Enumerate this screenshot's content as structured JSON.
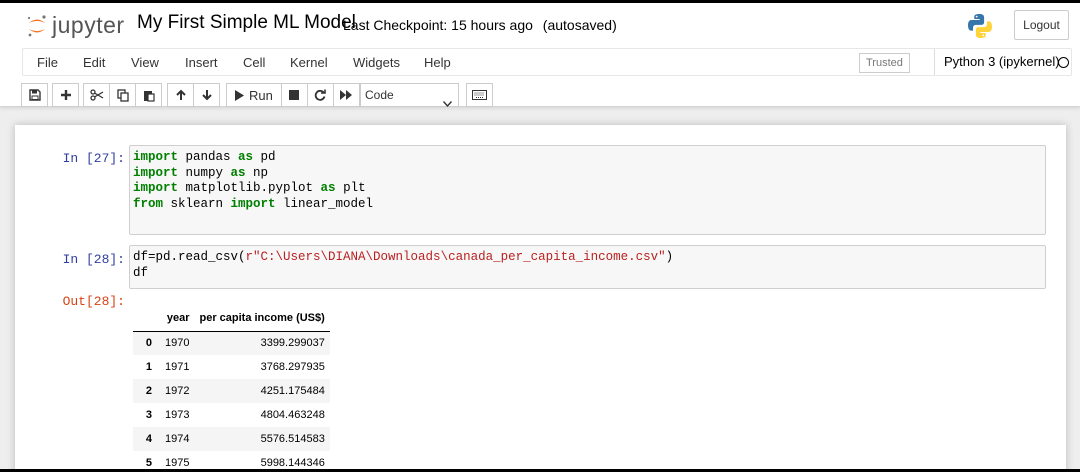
{
  "header": {
    "logo_text": "jupyter",
    "notebook_title": "My First Simple ML Model",
    "checkpoint": "Last Checkpoint: 15 hours ago",
    "autosaved": "(autosaved)",
    "logout_label": "Logout"
  },
  "menu": {
    "items": [
      "File",
      "Edit",
      "View",
      "Insert",
      "Cell",
      "Kernel",
      "Widgets",
      "Help"
    ],
    "trusted": "Trusted",
    "kernel": "Python 3 (ipykernel)"
  },
  "toolbar": {
    "run_label": "Run",
    "cell_type": "Code",
    "buttons": [
      "save-icon",
      "plus-icon",
      "cut-icon",
      "copy-icon",
      "paste-icon",
      "arrow-up-icon",
      "arrow-down-icon",
      "run-icon",
      "stop-icon",
      "restart-icon",
      "fast-forward-icon",
      "keyboard-icon"
    ]
  },
  "cells": [
    {
      "prompt": "In [27]:",
      "lines": [
        [
          {
            "t": "import",
            "k": "kw"
          },
          {
            "t": " pandas "
          },
          {
            "t": "as",
            "k": "kw"
          },
          {
            "t": " pd"
          }
        ],
        [
          {
            "t": "import",
            "k": "kw"
          },
          {
            "t": " numpy "
          },
          {
            "t": "as",
            "k": "kw"
          },
          {
            "t": " np"
          }
        ],
        [
          {
            "t": "import",
            "k": "kw"
          },
          {
            "t": " matplotlib.pyplot "
          },
          {
            "t": "as",
            "k": "kw"
          },
          {
            "t": " plt"
          }
        ],
        [
          {
            "t": "from",
            "k": "kw"
          },
          {
            "t": " sklearn "
          },
          {
            "t": "import",
            "k": "kw"
          },
          {
            "t": " linear_model"
          }
        ]
      ]
    },
    {
      "prompt": "In [28]:",
      "lines": [
        [
          {
            "t": "df=pd.read_csv("
          },
          {
            "t": "r\"C:\\Users\\DIANA\\Downloads\\canada_per_capita_income.csv\"",
            "k": "str"
          },
          {
            "t": ")"
          }
        ],
        [
          {
            "t": "df"
          }
        ]
      ]
    }
  ],
  "output": {
    "prompt": "Out[28]:",
    "columns": [
      "year",
      "per capita income (US$)"
    ],
    "rows": [
      {
        "index": "0",
        "year": "1970",
        "income": "3399.299037"
      },
      {
        "index": "1",
        "year": "1971",
        "income": "3768.297935"
      },
      {
        "index": "2",
        "year": "1972",
        "income": "4251.175484"
      },
      {
        "index": "3",
        "year": "1973",
        "income": "4804.463248"
      },
      {
        "index": "4",
        "year": "1974",
        "income": "5576.514583"
      },
      {
        "index": "5",
        "year": "1975",
        "income": "5998.144346"
      }
    ]
  },
  "colors": {
    "in_prompt": "#303F9F",
    "out_prompt": "#D84315",
    "keyword": "#008000",
    "string": "#BA2121",
    "jupyter_orange": "#F37726"
  }
}
